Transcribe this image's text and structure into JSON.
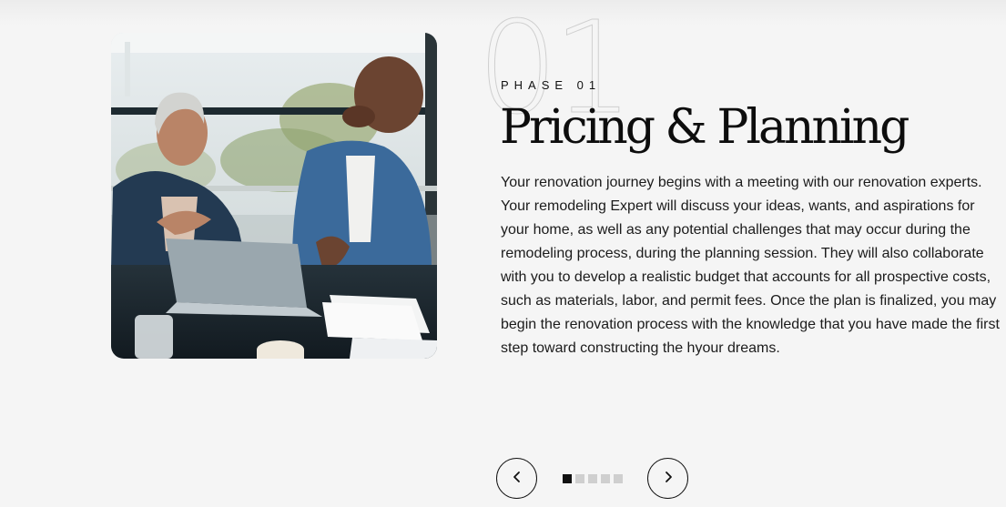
{
  "slide": {
    "number": "01",
    "phase_label": "PHASE 01",
    "title": "Pricing & Planning",
    "description": "Your renovation journey begins with a meeting with our renovation experts. Your remodeling Expert will discuss your ideas, wants, and aspirations for your home, as well as any potential challenges that may occur during the remodeling process, during the planning session. They will also collaborate with you to develop a realistic budget that accounts for all prospective costs, such as materials, labor, and permit fees. Once the plan is finalized, you may begin the renovation process with the knowledge that you have made the first step toward constructing the hyour dreams.",
    "image_icon": "photo-consultation-meeting"
  },
  "slider": {
    "prev_icon": "chevron-left-icon",
    "next_icon": "chevron-right-icon",
    "total_slides": 5,
    "active_index": 0
  },
  "colors": {
    "background": "#f5f5f5",
    "text": "#111111",
    "outline_number": "#cfcfcf",
    "dot_inactive": "#cfcfcf",
    "dot_active": "#111111"
  }
}
